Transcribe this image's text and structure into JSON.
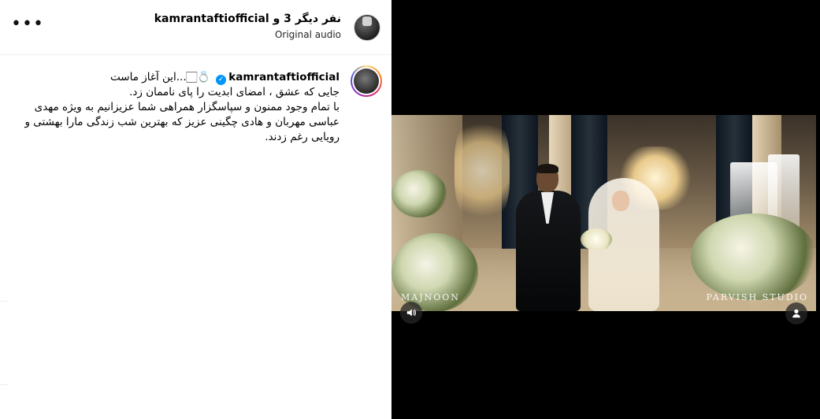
{
  "post": {
    "header": {
      "title": "نفر دیگر 3 و kamrantaftiofficial",
      "audio": "Original audio",
      "more_label": "•••"
    },
    "caption": {
      "username": "kamrantaftiofficial",
      "verified_icon": "verified-badge-icon",
      "first_line_text": "💍🏻...این آغاز ماست",
      "lines": [
        "جایی که عشق ، امضای ابدیت را پای ناممان زد.",
        "با تمام وجود ممنون و سپاسگزار همراهی شما عزیزانیم به ویژه مهدی",
        "عباسی مهربان و هادی چگینی عزیز که بهترین شب زندگی مارا بهشتی و",
        "رویایی رغم زدند."
      ]
    }
  },
  "video": {
    "watermark_left": "MAJNOON",
    "watermark_right": "PARVISH STUDIO",
    "controls": {
      "mute_icon": "speaker-icon",
      "tags_icon": "user-tag-icon"
    }
  },
  "colors": {
    "verified": "#0095f6",
    "divider": "#efefef",
    "video_background": "#000000"
  }
}
